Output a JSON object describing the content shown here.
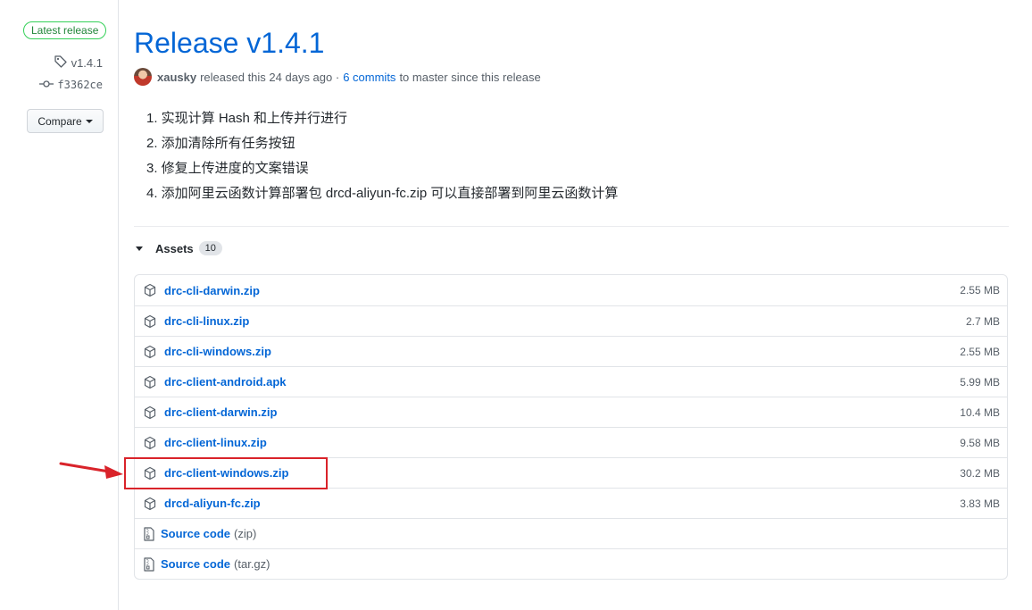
{
  "sidebar": {
    "latest_badge": "Latest release",
    "tag": "v1.4.1",
    "commit": "f3362ce",
    "compare_label": "Compare"
  },
  "release": {
    "title": "Release v1.4.1",
    "author": "xausky",
    "released_text": "released this 24 days ago ·",
    "commits_link": "6 commits",
    "since_text": "to master since this release",
    "notes": [
      "1. 实现计算 Hash 和上传并行进行",
      "2. 添加清除所有任务按钮",
      "3. 修复上传进度的文案错误",
      "4. 添加阿里云函数计算部署包 drcd-aliyun-fc.zip 可以直接部署到阿里云函数计算"
    ]
  },
  "assets": {
    "label": "Assets",
    "count": "10",
    "files": [
      {
        "name": "drc-cli-darwin.zip",
        "size": "2.55 MB"
      },
      {
        "name": "drc-cli-linux.zip",
        "size": "2.7 MB"
      },
      {
        "name": "drc-cli-windows.zip",
        "size": "2.55 MB"
      },
      {
        "name": "drc-client-android.apk",
        "size": "5.99 MB"
      },
      {
        "name": "drc-client-darwin.zip",
        "size": "10.4 MB"
      },
      {
        "name": "drc-client-linux.zip",
        "size": "9.58 MB"
      },
      {
        "name": "drc-client-windows.zip",
        "size": "30.2 MB"
      },
      {
        "name": "drcd-aliyun-fc.zip",
        "size": "3.83 MB"
      }
    ],
    "source": [
      {
        "label": "Source code",
        "ext": "(zip)"
      },
      {
        "label": "Source code",
        "ext": "(tar.gz)"
      }
    ]
  },
  "annotation": {
    "highlight_color": "#d9232a",
    "highlighted_item": "drc-client-windows.zip"
  },
  "colors": {
    "link": "#0366d6",
    "badge_green": "#22863a"
  }
}
